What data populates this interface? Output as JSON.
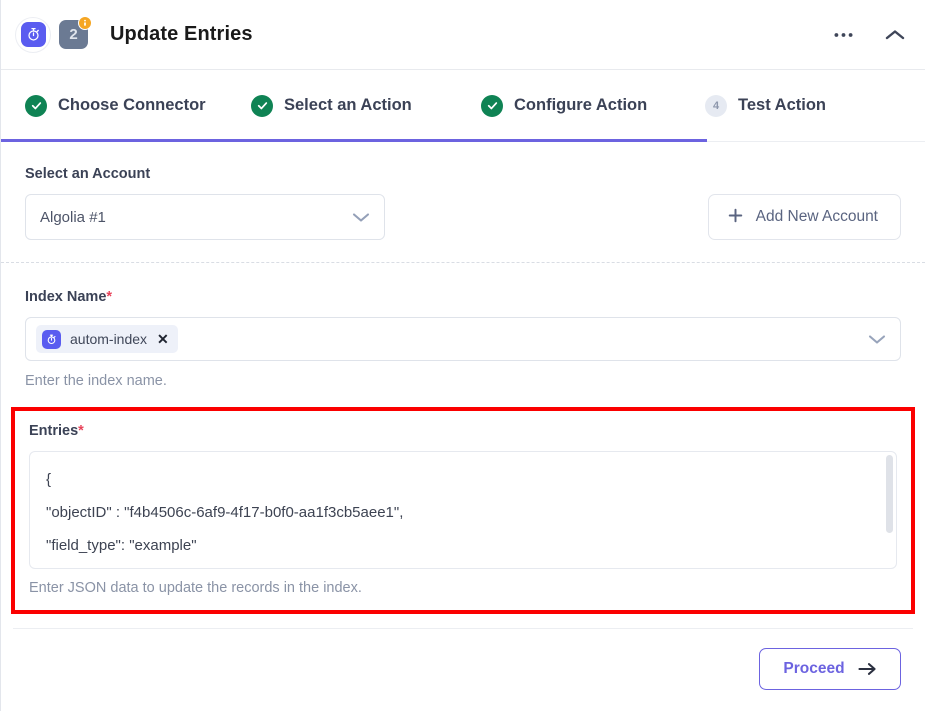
{
  "header": {
    "title": "Update Entries",
    "app_icon": "stopwatch-icon",
    "step_badge_number": "2",
    "badge_alert_icon": "info-badge-icon",
    "more_icon": "ellipsis-icon",
    "collapse_icon": "chevron-up-icon"
  },
  "steps": [
    {
      "label": "Choose Connector",
      "state": "complete",
      "marker": "check-icon"
    },
    {
      "label": "Select an Action",
      "state": "complete",
      "marker": "check-icon"
    },
    {
      "label": "Configure Action",
      "state": "complete",
      "marker": "check-icon"
    },
    {
      "label": "Test Action",
      "state": "upcoming",
      "marker": "4"
    }
  ],
  "account": {
    "label": "Select an Account",
    "selected": "Algolia #1",
    "dropdown_icon": "chevron-down-icon",
    "add_button_label": "Add New Account",
    "add_button_icon": "plus-icon"
  },
  "index": {
    "label": "Index Name",
    "required_marker": "*",
    "chip_label": "autom-index",
    "chip_icon": "stopwatch-icon",
    "chip_remove_icon": "✕",
    "dropdown_icon": "chevron-down-icon",
    "helper": "Enter the index name."
  },
  "entries": {
    "label": "Entries",
    "required_marker": "*",
    "value_lines": [
      "{",
      "\"objectID\" : \"f4b4506c-6af9-4f17-b0f0-aa1f3cb5aee1\",",
      "\"field_type\": \"example\""
    ],
    "helper": "Enter JSON data to update the records in the index.",
    "highlight_color": "#fb0000"
  },
  "footer": {
    "proceed_label": "Proceed",
    "proceed_icon": "arrow-right-icon"
  },
  "colors": {
    "accent_purple": "#6c63e0",
    "app_blue": "#5a5cf0",
    "success_green": "#0f8354",
    "required_red": "#e8435a",
    "badge_orange": "#f5a623",
    "text_dark": "#3b4256",
    "text_muted": "#8a93a6"
  }
}
